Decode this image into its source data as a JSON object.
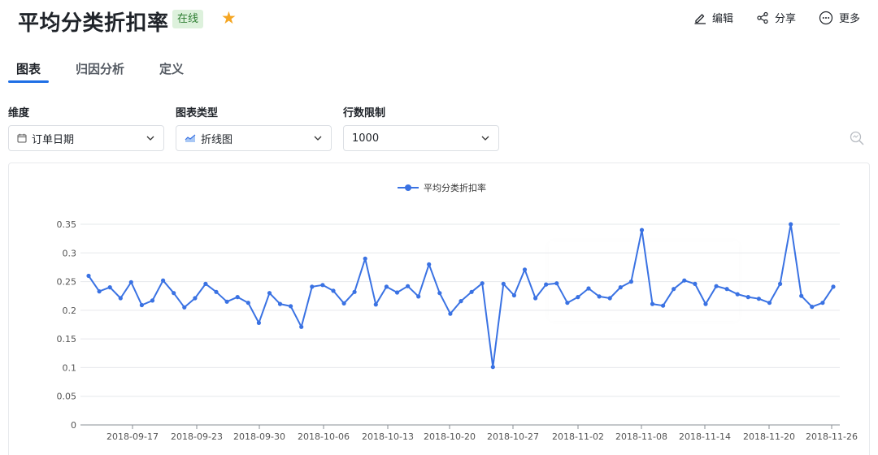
{
  "header": {
    "title": "平均分类折扣率",
    "status_badge": "在线",
    "actions": {
      "edit": "编辑",
      "share": "分享",
      "more": "更多"
    }
  },
  "tabs": [
    {
      "label": "图表",
      "active": true
    },
    {
      "label": "归因分析",
      "active": false
    },
    {
      "label": "定义",
      "active": false
    }
  ],
  "controls": {
    "dimension": {
      "label": "维度",
      "value": "订单日期"
    },
    "chart_type": {
      "label": "图表类型",
      "value": "折线图"
    },
    "row_limit": {
      "label": "行数限制",
      "value": "1000"
    }
  },
  "colors": {
    "accent": "#1f6fe5",
    "series": "#3a72e3",
    "star": "#f5a623",
    "badge_bg": "#ddf1dc",
    "badge_text": "#2e7d32"
  },
  "chart_data": {
    "type": "line",
    "legend": "平均分类折扣率",
    "legend_position": "top-center",
    "grid": true,
    "ylim": [
      0,
      0.35
    ],
    "yticks": [
      "0.35",
      "0.3",
      "0.25",
      "0.2",
      "0.15",
      "0.1",
      "0.05",
      "0"
    ],
    "xticks": [
      "2018-09-17",
      "2018-09-23",
      "2018-09-30",
      "2018-10-06",
      "2018-10-13",
      "2018-10-20",
      "2018-10-27",
      "2018-11-02",
      "2018-11-08",
      "2018-11-14",
      "2018-11-20",
      "2018-11-26"
    ],
    "series": [
      {
        "name": "平均分类折扣率",
        "values": [
          0.26,
          0.233,
          0.24,
          0.221,
          0.249,
          0.209,
          0.217,
          0.252,
          0.23,
          0.205,
          0.221,
          0.246,
          0.232,
          0.215,
          0.223,
          0.213,
          0.178,
          0.23,
          0.211,
          0.207,
          0.171,
          0.241,
          0.244,
          0.234,
          0.212,
          0.232,
          0.29,
          0.21,
          0.241,
          0.231,
          0.242,
          0.224,
          0.28,
          0.23,
          0.194,
          0.216,
          0.232,
          0.247,
          0.101,
          0.246,
          0.226,
          0.271,
          0.221,
          0.245,
          0.247,
          0.213,
          0.223,
          0.238,
          0.224,
          0.221,
          0.24,
          0.25,
          0.34,
          0.211,
          0.208,
          0.237,
          0.252,
          0.246,
          0.211,
          0.242,
          0.237,
          0.228,
          0.223,
          0.22,
          0.213,
          0.246,
          0.35,
          0.225,
          0.206,
          0.213,
          0.241
        ]
      }
    ]
  }
}
